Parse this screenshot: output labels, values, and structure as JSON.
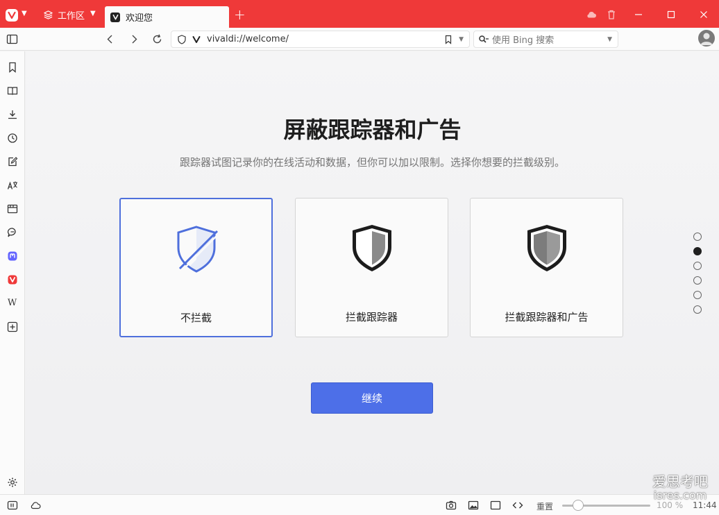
{
  "tabbar": {
    "workspace_label": "工作区",
    "active_tab_title": "欢迎您",
    "new_tab_symbol": "+"
  },
  "addressbar": {
    "url": "vivaldi://welcome/",
    "search_placeholder": "使用 Bing 搜索"
  },
  "page": {
    "heading": "屏蔽跟踪器和广告",
    "subtitle": "跟踪器试图记录你的在线活动和数据，但你可以加以限制。选择你想要的拦截级别。",
    "options": [
      {
        "label": "不拦截",
        "selected": true,
        "icon": "shield-off-icon"
      },
      {
        "label": "拦截跟踪器",
        "selected": false,
        "icon": "shield-half-icon"
      },
      {
        "label": "拦截跟踪器和广告",
        "selected": false,
        "icon": "shield-full-icon"
      }
    ],
    "continue_label": "继续",
    "steps_total": 6,
    "step_current": 2
  },
  "sidepanel": {
    "wiki_letter": "W"
  },
  "statusbar": {
    "reset_label": "重置",
    "zoom_label": "100 %",
    "time": "11:44"
  },
  "watermark": {
    "line1": "爱思考吧",
    "line2": "isres.com"
  },
  "colors": {
    "accent_red": "#ef3939",
    "primary_blue": "#4d6fe8",
    "selected_border": "#4e6fdc"
  }
}
